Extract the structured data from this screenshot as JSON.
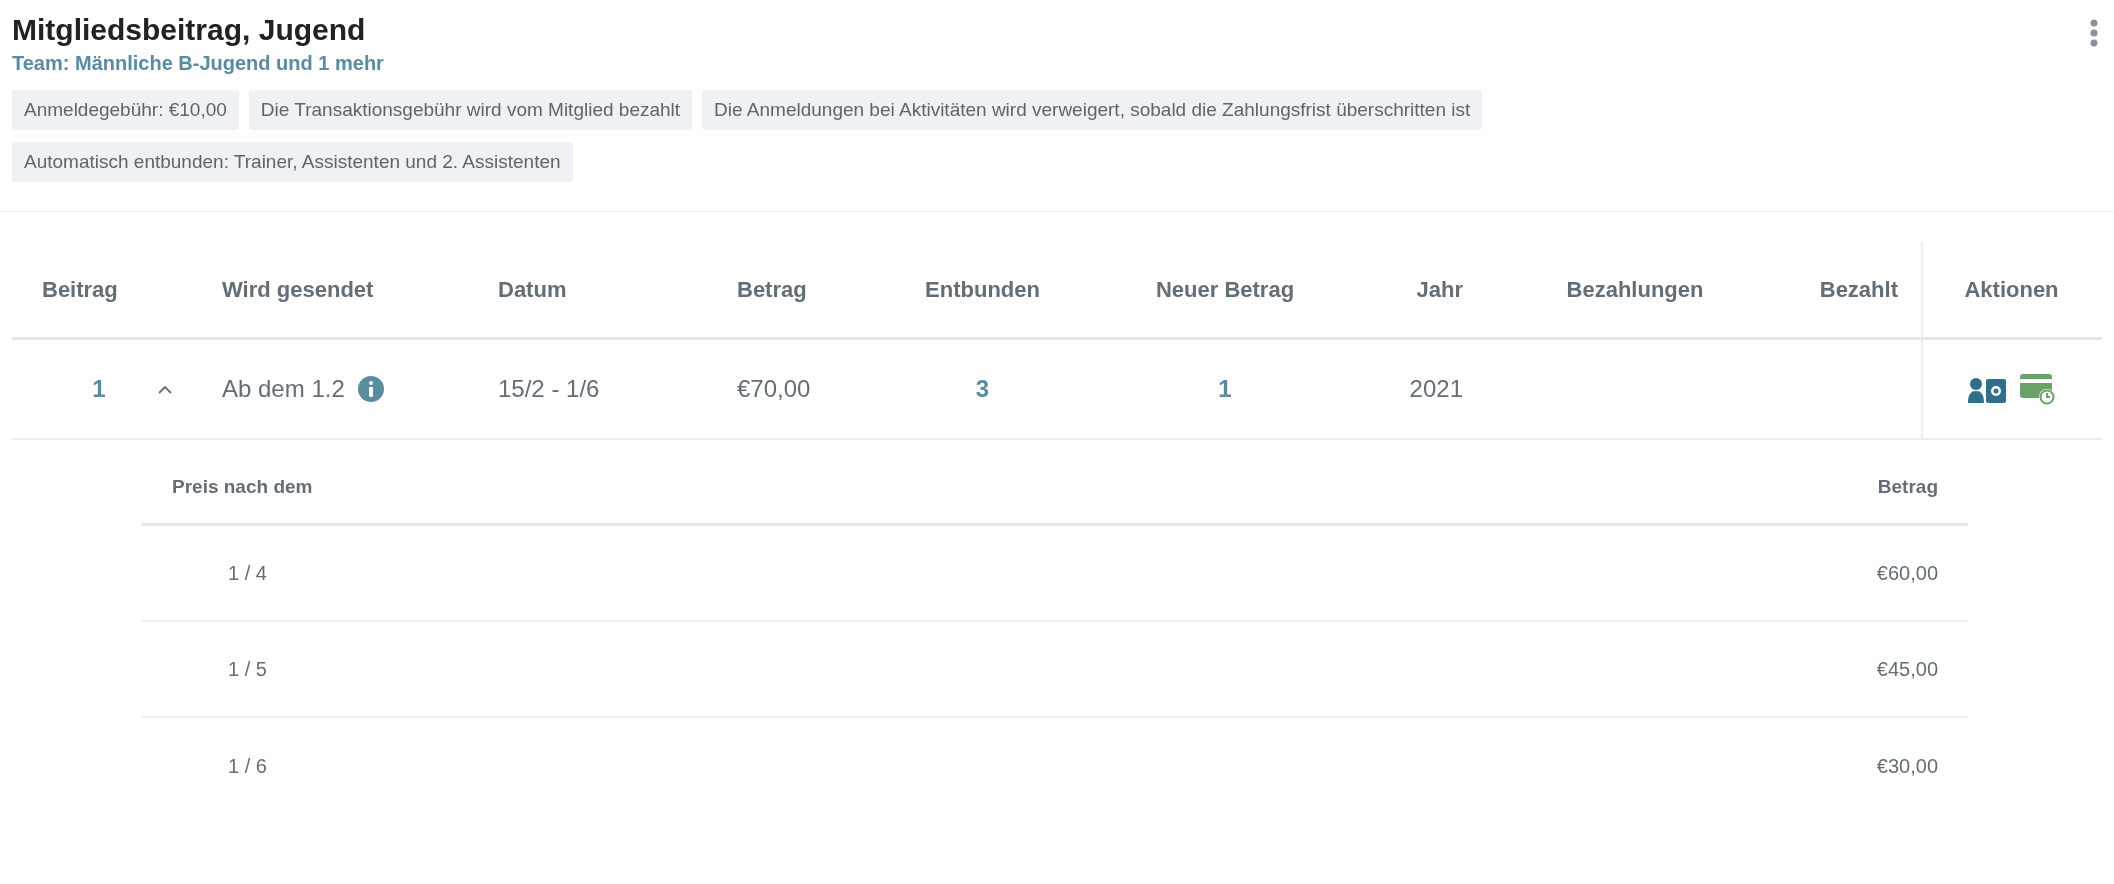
{
  "header": {
    "title": "Mitgliedsbeitrag, Jugend",
    "subtitle": "Team: Männliche B-Jugend und 1 mehr"
  },
  "tags": [
    "Anmeldegebühr: €10,00",
    "Die Transaktionsgebühr wird vom Mitglied bezahlt",
    "Die Anmeldungen bei Aktivitäten wird verweigert, sobald die Zahlungsfrist überschritten ist",
    "Automatisch entbunden: Trainer, Assistenten und 2. Assistenten"
  ],
  "table": {
    "columns": [
      "Beitrag",
      "Wird gesendet",
      "Datum",
      "Betrag",
      "Entbunden",
      "Neuer Betrag",
      "Jahr",
      "Bezahlungen",
      "Bezahlt",
      "Aktionen"
    ],
    "rows": [
      {
        "beitrag": "1",
        "expanded": true,
        "wird_gesendet": "Ab dem 1.2",
        "datum": "15/2 - 1/6",
        "betrag": "€70,00",
        "entbunden": "3",
        "neuer_betrag": "1",
        "jahr": "2021",
        "actions": [
          {
            "kind": "member-payment"
          },
          {
            "kind": "card-schedule"
          }
        ],
        "details": {
          "columns": [
            "Preis nach dem",
            "Betrag"
          ],
          "rows": [
            {
              "date": "1 / 4",
              "amount": "€60,00"
            },
            {
              "date": "1 / 5",
              "amount": "€45,00"
            },
            {
              "date": "1 / 6",
              "amount": "€30,00"
            }
          ]
        }
      }
    ]
  }
}
